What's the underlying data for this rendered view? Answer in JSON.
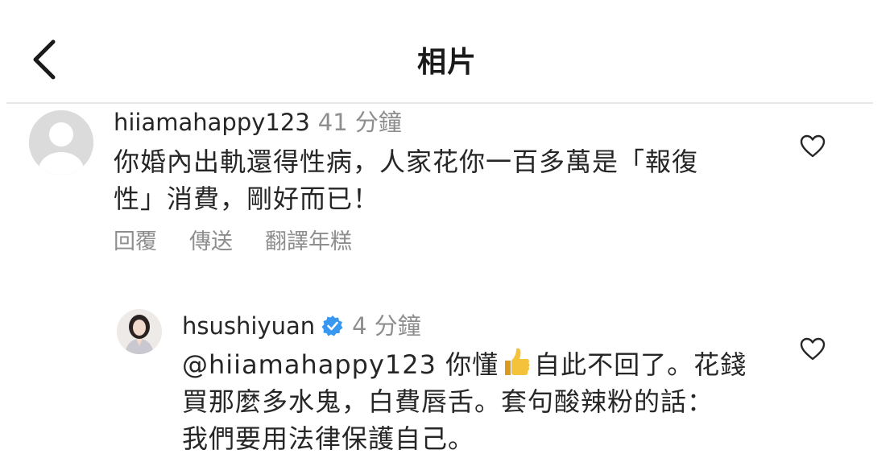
{
  "header": {
    "title": "相片"
  },
  "comment": {
    "username": "hiiamahappy123",
    "time": "41 分鐘",
    "text_lines": [
      "你婚內出軌還得性病，人家花你一百多萬是「報復",
      "性」消費，剛好而已！"
    ],
    "actions": {
      "reply": "回覆",
      "translate": "傳送",
      "see_translation": "翻譯年糕"
    }
  },
  "reply": {
    "username": "hsushiyuan",
    "time": "4 分鐘",
    "mention": "@hiiamahappy123",
    "line1_after_mention": " 你懂",
    "line1_after_emoji": "自此不回了。花錢",
    "line2": "買那麼多水鬼，白費唇舌。套句酸辣粉的話：",
    "line3": "我們要用法律保護自己。"
  },
  "colors": {
    "text": "#262626",
    "secondary": "#8e8e8e",
    "verified": "#3897f0"
  }
}
